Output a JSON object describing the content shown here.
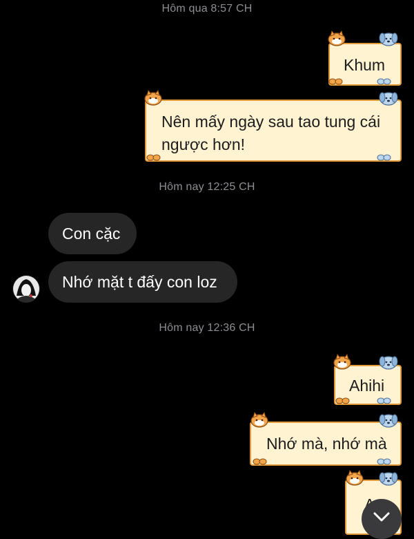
{
  "timestamps": {
    "yesterday": "Hôm qua 8:57 CH",
    "today_1225": "Hôm nay 12:25 CH",
    "today_1236": "Hôm nay 12:36 CH"
  },
  "messages": {
    "out_1": "Khum",
    "out_2_line1": "Nên mấy ngày sau tao tung cái",
    "out_2_line2": "ngược hơn!",
    "in_1": "Con cặc",
    "in_2": "Nhớ mặt t đấy con loz",
    "out_3": "Ahihi",
    "out_4": "Nhớ mà, nhớ mà",
    "out_5_partial": "A"
  },
  "colors": {
    "outgoing_bubble_bg": "#fff3d2",
    "outgoing_bubble_border": "#e09a3a",
    "incoming_bubble_bg": "#262626",
    "timestamp_text": "#8e8e93",
    "background": "#000000"
  },
  "icons": {
    "cat_sticker": "orange-cat-icon",
    "dog_sticker": "blue-dog-icon",
    "paws": "paw-icon",
    "scroll_down": "chevron-down-icon",
    "avatar": "contact-avatar"
  }
}
